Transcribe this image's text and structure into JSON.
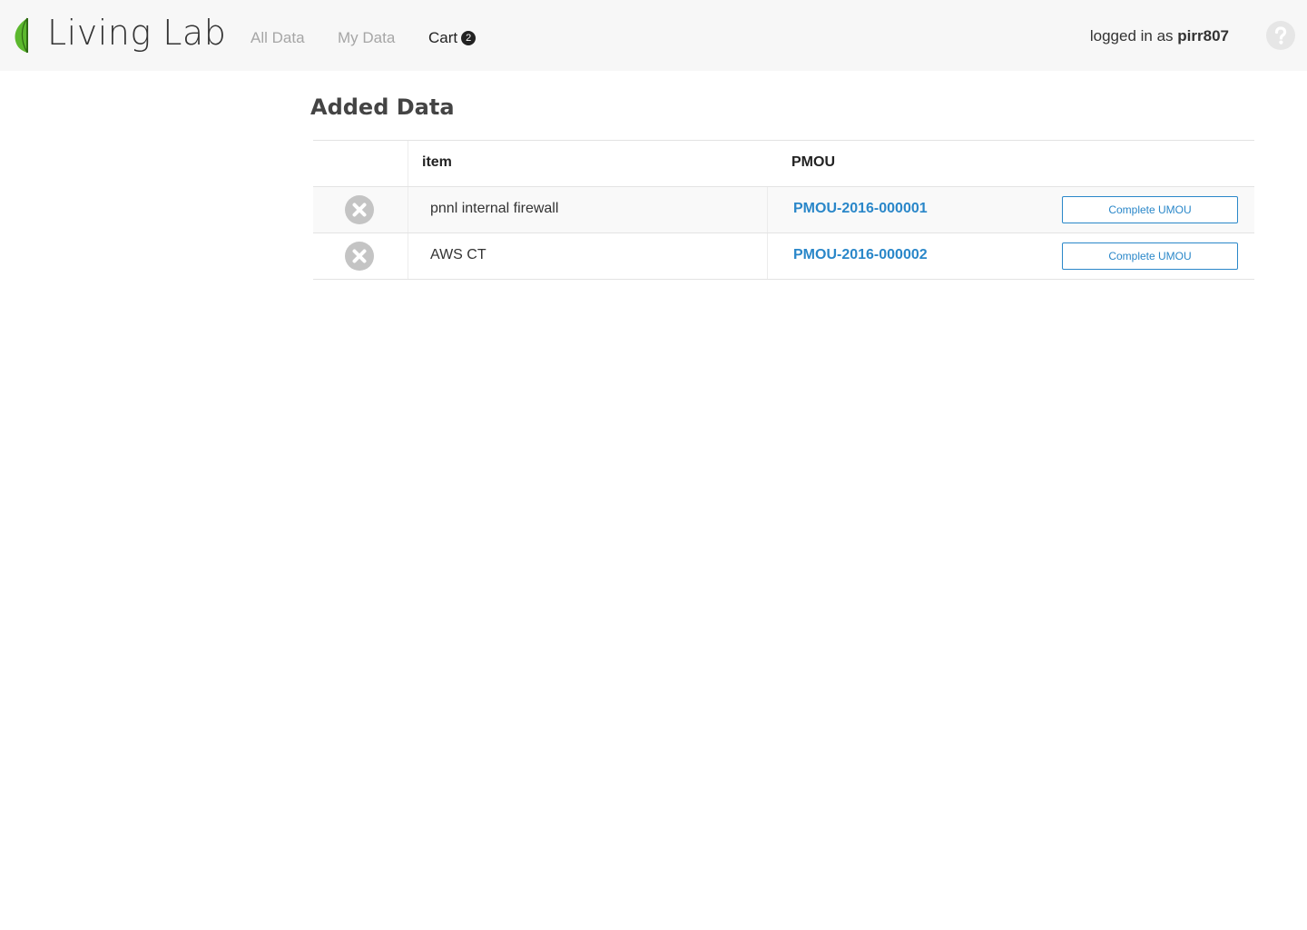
{
  "header": {
    "brand": "Living Lab",
    "nav": {
      "all_data": "All Data",
      "my_data": "My Data",
      "cart": "Cart",
      "cart_count": "2"
    },
    "user": {
      "prefix": "logged in as",
      "username": "pirr807"
    },
    "help_icon": "question-circle-icon"
  },
  "main": {
    "title": "Added Data",
    "table": {
      "columns": [
        "item",
        "PMOU"
      ],
      "rows": [
        {
          "item": "pnnl internal firewall",
          "pmou": "PMOU-2016-000001",
          "action": "Complete UMOU"
        },
        {
          "item": "AWS CT",
          "pmou": "PMOU-2016-000002",
          "action": "Complete UMOU"
        }
      ]
    }
  },
  "colors": {
    "link": "#2a87c9",
    "header_bg": "#f7f7f7",
    "leaf": "#5cb82e"
  }
}
